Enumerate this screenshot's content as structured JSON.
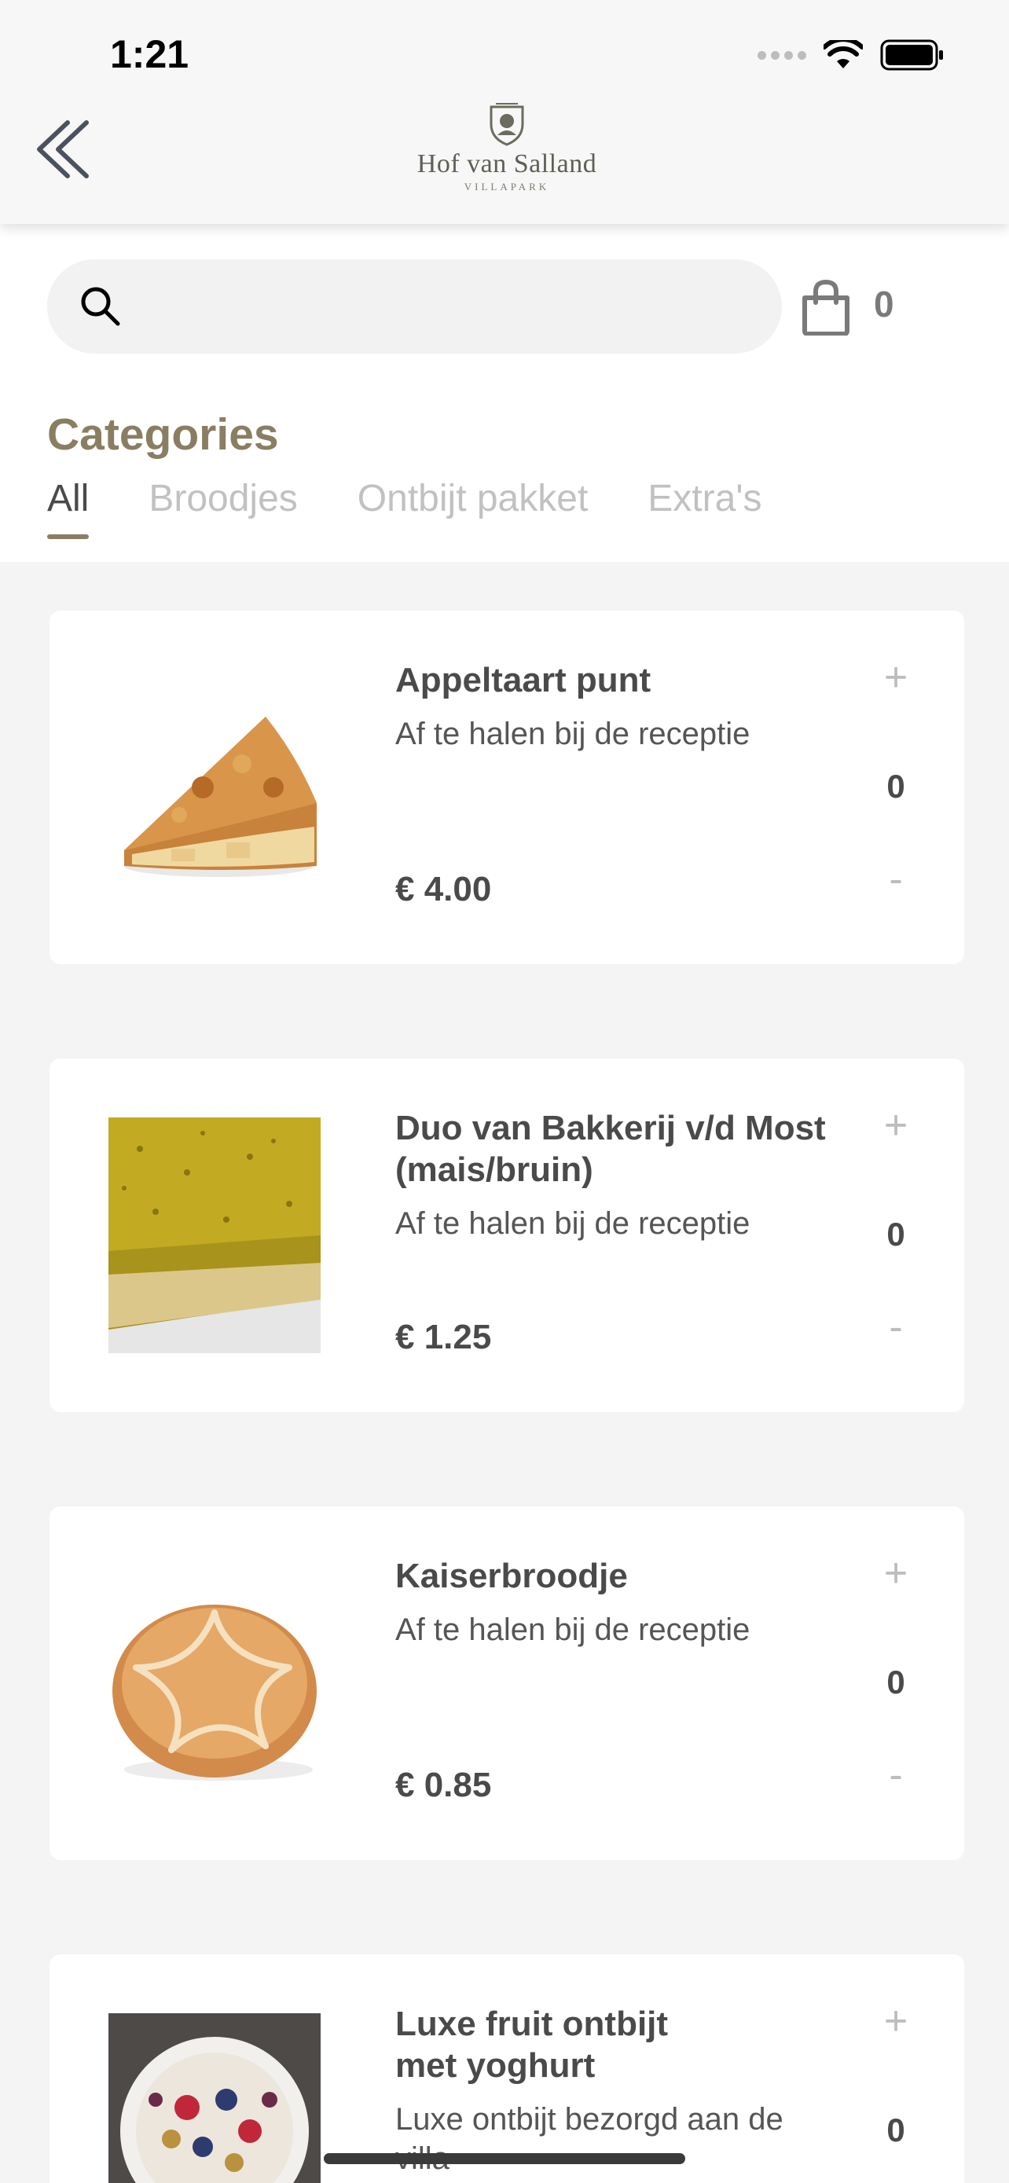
{
  "status_bar": {
    "time": "1:21"
  },
  "header": {
    "logo_name": "Hof van Salland",
    "logo_sub": "VILLAPARK",
    "back_icon": "double-chevron-left-icon"
  },
  "search": {
    "value": "",
    "placeholder": ""
  },
  "cart": {
    "count": "0",
    "icon": "shopping-bag-icon"
  },
  "categories": {
    "title": "Categories",
    "tabs": [
      "All",
      "Broodjes",
      "Ontbijt pakket",
      "Extra's"
    ],
    "active_tab": "All"
  },
  "products": [
    {
      "title": "Appeltaart punt",
      "description": "Af te halen bij de receptie",
      "price": "€ 4.00",
      "quantity": "0",
      "plus": "+",
      "minus": "-"
    },
    {
      "title": "Duo van Bakkerij v/d Most (mais/bruin)",
      "description": "Af te halen bij de receptie",
      "price": "€ 1.25",
      "quantity": "0",
      "plus": "+",
      "minus": "-"
    },
    {
      "title": "Kaiserbroodje",
      "description": "Af te halen bij de receptie",
      "price": "€ 0.85",
      "quantity": "0",
      "plus": "+",
      "minus": "-"
    },
    {
      "title": "Luxe fruit ontbijt met yoghurt",
      "description": "Luxe ontbijt bezorgd aan de villa",
      "price": "",
      "quantity": "0",
      "plus": "+",
      "minus": "-"
    }
  ],
  "colors": {
    "accent": "#8a7e62",
    "background": "#f4f4f4",
    "inactive_tab": "#c1c1c1"
  }
}
